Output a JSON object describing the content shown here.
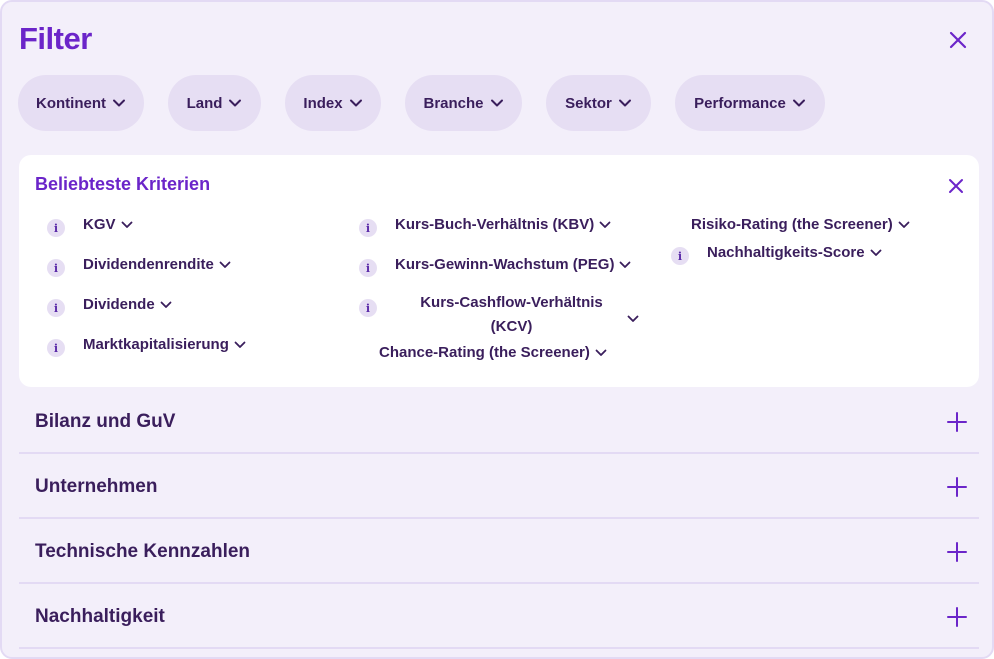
{
  "header": {
    "title": "Filter"
  },
  "chips": [
    {
      "label": "Kontinent"
    },
    {
      "label": "Land"
    },
    {
      "label": "Index"
    },
    {
      "label": "Branche"
    },
    {
      "label": "Sektor"
    },
    {
      "label": "Performance"
    }
  ],
  "popular": {
    "title": "Beliebteste Kriterien",
    "info_glyph": "i",
    "col1": [
      "KGV",
      "Dividendenrendite",
      "Dividende",
      "Marktkapitalisierung"
    ],
    "col2": [
      "Kurs-Buch-Verhältnis (KBV)",
      "Kurs-Gewinn-Wachstum (PEG)",
      "Kurs-Cashflow-Verhältnis (KCV)",
      "Chance-Rating (the Screener)"
    ],
    "col3": [
      "Risiko-Rating (the Screener)",
      "Nachhaltigkeits-Score"
    ]
  },
  "sections": [
    {
      "label": "Bilanz und GuV"
    },
    {
      "label": "Unternehmen"
    },
    {
      "label": "Technische Kennzahlen"
    },
    {
      "label": "Nachhaltigkeit"
    }
  ],
  "colors": {
    "accent": "#6b25c9",
    "text": "#3a1e5c",
    "panel": "#f3effa",
    "chip": "#e6def3"
  },
  "icons": [
    "close-icon",
    "chevron-down-icon",
    "info-icon",
    "plus-icon"
  ]
}
